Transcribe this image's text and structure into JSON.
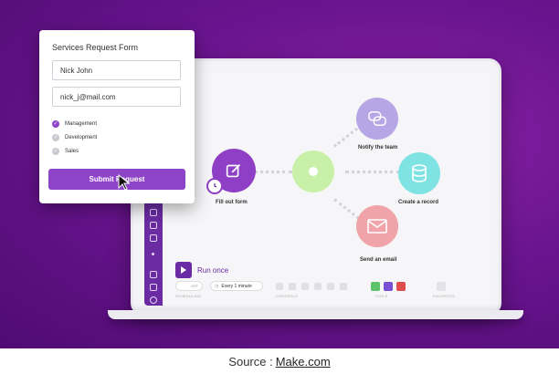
{
  "form": {
    "title": "Services Request Form",
    "name_value": "Nick John",
    "email_value": "nick_j@mail.com",
    "options": [
      {
        "label": "Management",
        "checked": true
      },
      {
        "label": "Development",
        "checked": false
      },
      {
        "label": "Sales",
        "checked": false
      }
    ],
    "submit_label": "Submit Request"
  },
  "scenario": {
    "nodes": {
      "fill_form": "Fill out form",
      "notify": "Notify the team",
      "record": "Create a record",
      "email": "Send an email"
    },
    "run_label": "Run once",
    "schedule": {
      "toggle_label": "OFF",
      "interval": "Every 1 minute",
      "section_scheduling": "SCHEDULING",
      "section_controls": "CONTROLS",
      "section_tools": "TOOLS",
      "section_favorites": "FAVORITES"
    }
  },
  "colors": {
    "brand_purple": "#6a2ba3",
    "form_node": "#8e3fc6",
    "router_node": "#c8f0a8",
    "notify_node": "#b7a6e6",
    "record_node": "#7fe3e3",
    "email_node": "#f0a3a8"
  },
  "caption": {
    "prefix": "Source :",
    "link": "Make.com"
  }
}
